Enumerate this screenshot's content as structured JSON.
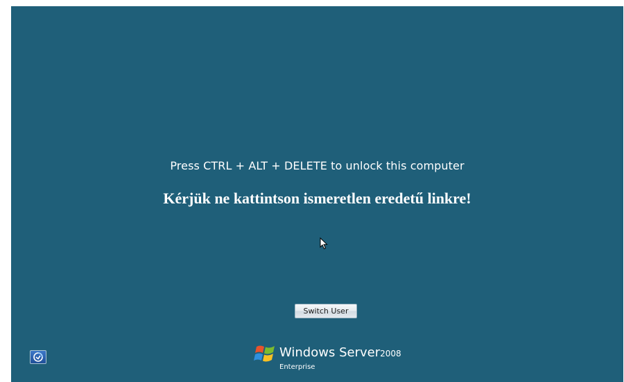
{
  "lock_screen": {
    "prompt": "Press CTRL + ALT + DELETE to unlock this computer",
    "notice": "Kérjük ne kattintson ismeretlen eredetű linkre!"
  },
  "buttons": {
    "switch_user": "Switch User",
    "ease_of_access_icon": "ease-of-access-icon"
  },
  "branding": {
    "logo_icon": "windows-flag-icon",
    "product": "Windows Server",
    "version": "2008",
    "edition": "Enterprise"
  },
  "colors": {
    "background": "#1f5f79",
    "text": "#ffffff"
  }
}
